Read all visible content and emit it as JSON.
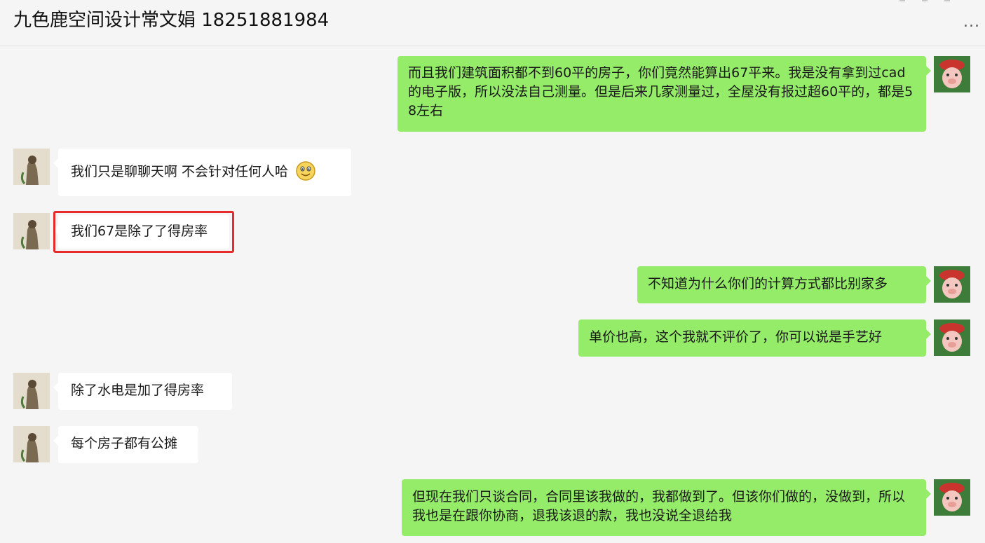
{
  "header": {
    "title": "九色鹿空间设计常文娟 18251881984",
    "more_label": "..."
  },
  "messages": [
    {
      "side": "right",
      "text": "而且我们建筑面积都不到60平的房子，你们竟然能算出67平来。我是没有拿到过cad的电子版，所以没法自己测量。但是后来几家测量过，全屋没有报过超60平的，都是58左右"
    },
    {
      "side": "left",
      "text": "我们只是聊聊天啊 不会针对任何人哈",
      "emoji": "smiley-icon"
    },
    {
      "side": "left",
      "text": "我们67是除了了得房率",
      "highlighted": true,
      "highlight_color": "#e52b2b"
    },
    {
      "side": "right",
      "text": "不知道为什么你们的计算方式都比别家多"
    },
    {
      "side": "right",
      "text": "单价也高，这个我就不评价了，你可以说是手艺好"
    },
    {
      "side": "left",
      "text": "除了水电是加了得房率"
    },
    {
      "side": "left",
      "text": "每个房子都有公摊"
    },
    {
      "side": "right",
      "text": "但现在我们只谈合同，合同里该我做的，我都做到了。但该你们做的，没做到，所以我也是在跟你协商，退我该退的款，我也没说全退给我"
    }
  ],
  "colors": {
    "background": "#f5f5f5",
    "bubble_self": "#95ec69",
    "bubble_other": "#ffffff",
    "highlight": "#e52b2b"
  }
}
